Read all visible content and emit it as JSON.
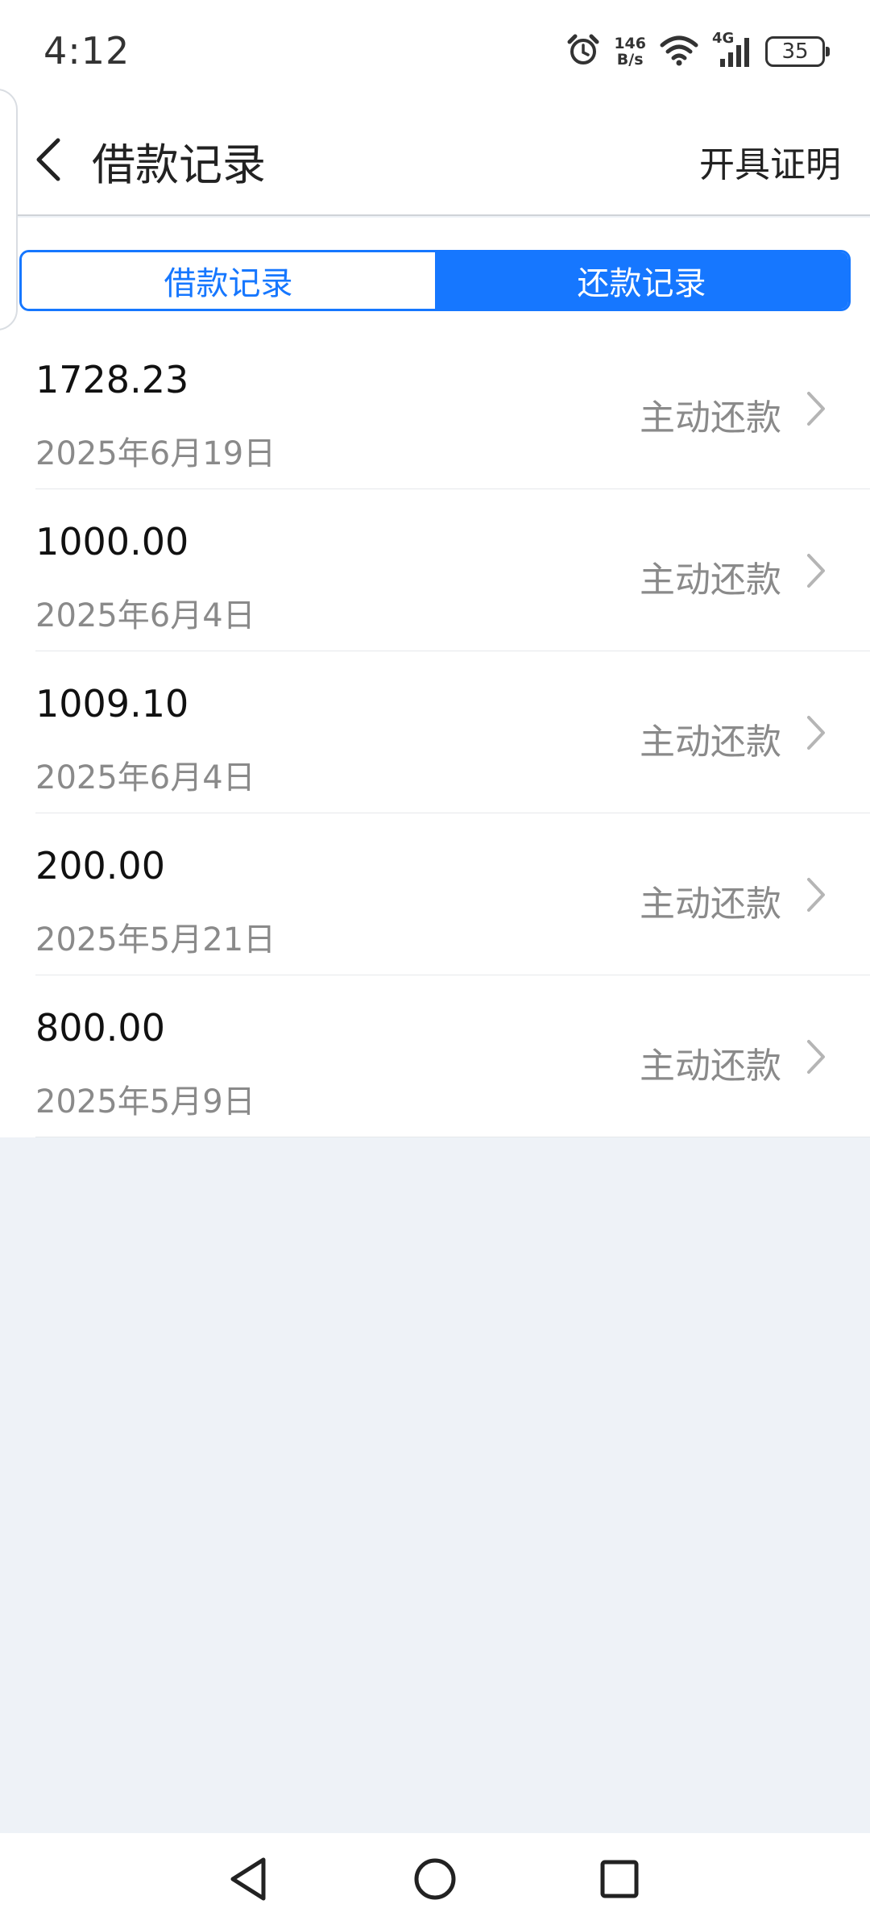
{
  "status_bar": {
    "time": "4:12",
    "net_speed_value": "146",
    "net_speed_unit": "B/s",
    "network_type": "4G",
    "battery": "35",
    "icons": [
      "alarm-icon",
      "wifi-icon",
      "cellular-signal-icon",
      "battery-icon"
    ]
  },
  "header": {
    "title": "借款记录",
    "action": "开具证明",
    "back_icon": "chevron-left-icon"
  },
  "tabs": [
    {
      "label": "借款记录",
      "active": false
    },
    {
      "label": "还款记录",
      "active": true
    }
  ],
  "records": [
    {
      "amount": "1728.23",
      "date": "2025年6月19日",
      "type": "主动还款"
    },
    {
      "amount": "1000.00",
      "date": "2025年6月4日",
      "type": "主动还款"
    },
    {
      "amount": "1009.10",
      "date": "2025年6月4日",
      "type": "主动还款"
    },
    {
      "amount": "200.00",
      "date": "2025年5月21日",
      "type": "主动还款"
    },
    {
      "amount": "800.00",
      "date": "2025年5月9日",
      "type": "主动还款"
    }
  ],
  "colors": {
    "accent": "#1677ff",
    "page_background": "#eef2f7",
    "secondary_text": "#8a8a8a"
  },
  "nav": [
    "back-triangle-icon",
    "home-circle-icon",
    "recents-square-icon"
  ]
}
